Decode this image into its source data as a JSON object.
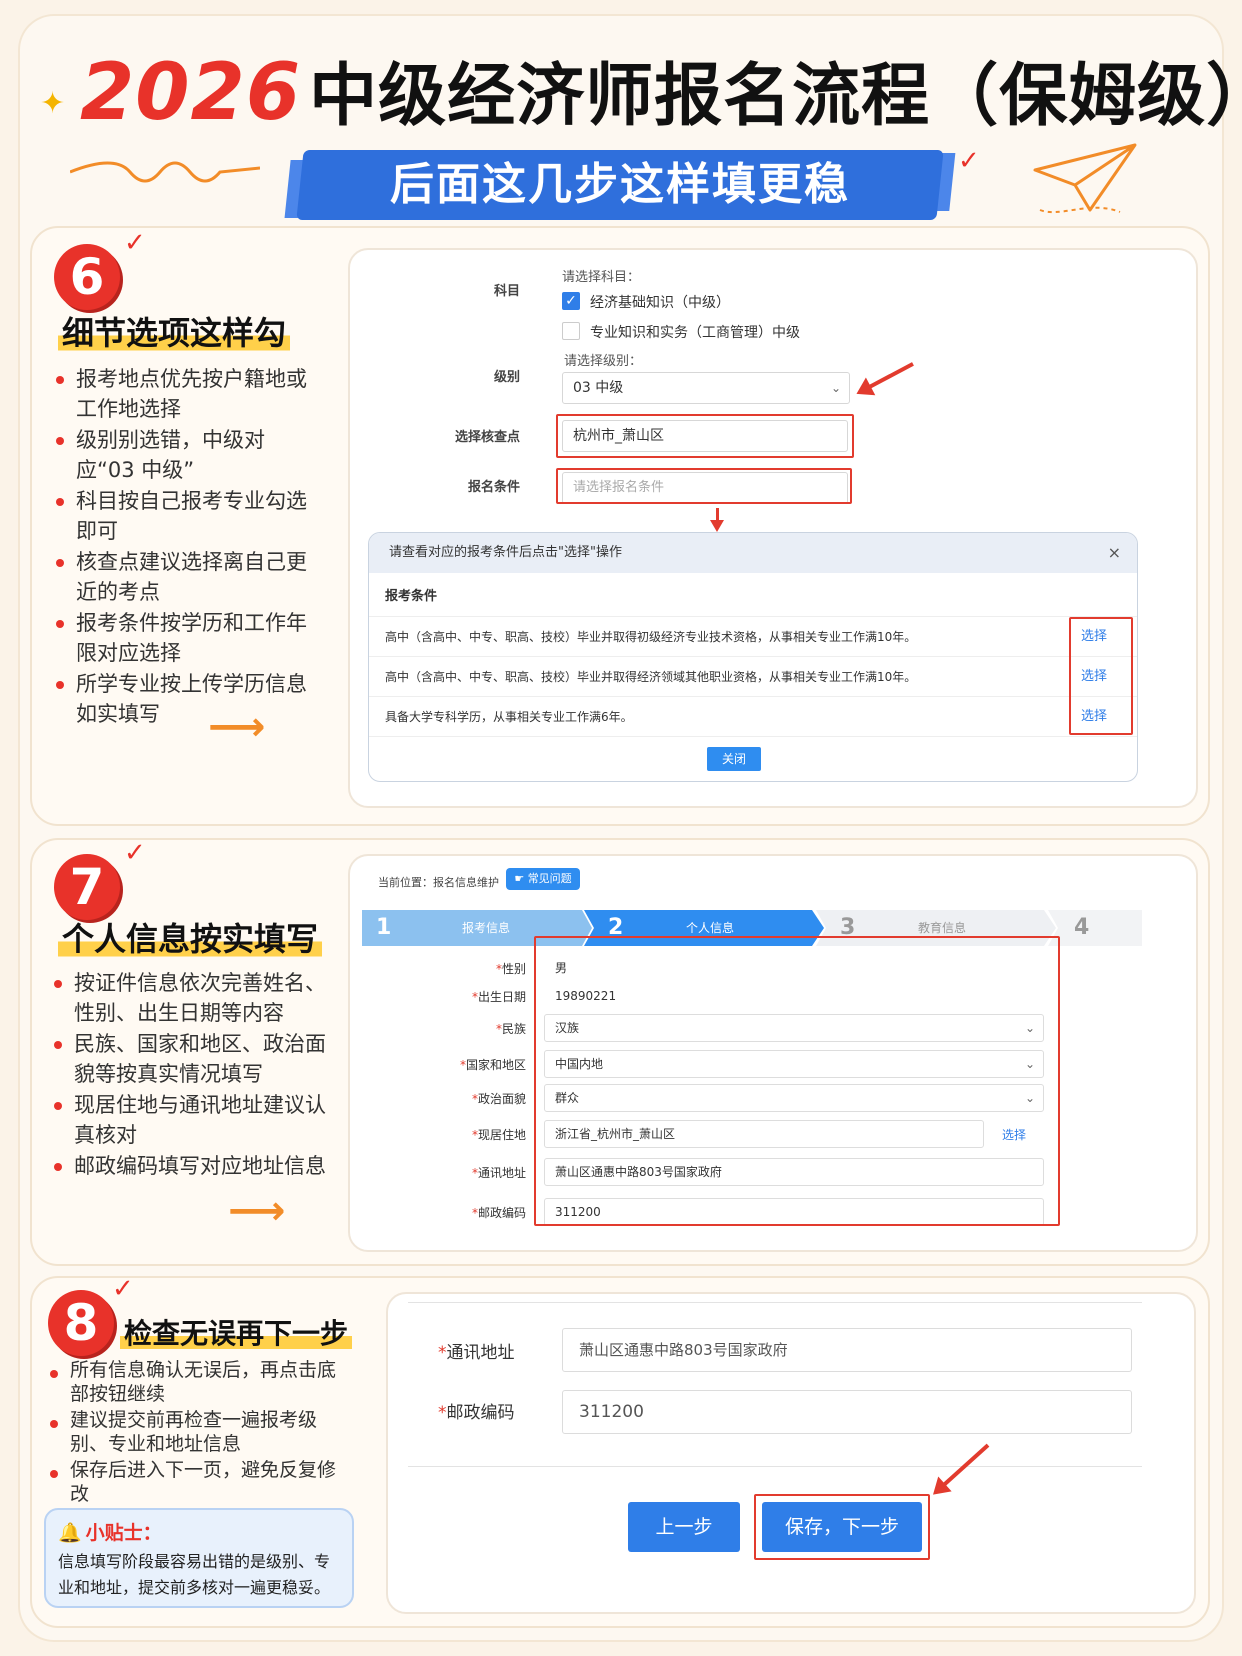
{
  "header": {
    "year": "2026",
    "title_rest": "中级经济师报名流程（保姆级）",
    "banner": "后面这几步这样填更稳"
  },
  "sec6": {
    "num": "6",
    "title": "细节选项这样勾",
    "bullets": [
      "报考地点优先按户籍地或工作地选择",
      "级别别选错，中级对应“03 中级”",
      "科目按自己报考专业勾选即可",
      "核查点建议选择离自己更近的考点",
      "报考条件按学历和工作年限对应选择",
      "所学专业按上传学历信息如实填写"
    ],
    "screen": {
      "subject_label": "科目",
      "subject_hint": "请选择科目：",
      "subject_opt1": "经济基础知识（中级）",
      "subject_opt2": "专业知识和实务（工商管理）中级",
      "level_hint": "请选择级别：",
      "level_label": "级别",
      "level_value": "03 中级",
      "check_label": "选择核查点",
      "check_value": "杭州市_萧山区",
      "cond_label": "报名条件",
      "cond_placeholder": "请选择报名条件",
      "dialog_title": "请查看对应的报考条件后点击\"选择\"操作",
      "dialog_close_icon": "×",
      "dialog_sub": "报考条件",
      "conditions": [
        "高中（含高中、中专、职高、技校）毕业并取得初级经济专业技术资格，从事相关专业工作满10年。",
        "高中（含高中、中专、职高、技校）毕业并取得经济领域其他职业资格，从事相关专业工作满10年。",
        "具备大学专科学历，从事相关专业工作满6年。"
      ],
      "select_label": "选择",
      "close_btn": "关闭"
    }
  },
  "sec7": {
    "num": "7",
    "title": "个人信息按实填写",
    "bullets": [
      "按证件信息依次完善姓名、性别、出生日期等内容",
      "民族、国家和地区、政治面貌等按真实情况填写",
      "现居住地与通讯地址建议认真核对",
      "邮政编码填写对应地址信息"
    ],
    "screen": {
      "crumb": "当前位置：报名信息维护",
      "faq": "常见问题",
      "steps": [
        {
          "num": "1",
          "name": "报考信息"
        },
        {
          "num": "2",
          "name": "个人信息"
        },
        {
          "num": "3",
          "name": "教育信息"
        },
        {
          "num": "4",
          "name": ""
        }
      ],
      "rows": [
        {
          "label": "性别",
          "value": "男",
          "type": "plain"
        },
        {
          "label": "出生日期",
          "value": "19890221",
          "type": "plain"
        },
        {
          "label": "民族",
          "value": "汉族",
          "type": "select"
        },
        {
          "label": "国家和地区",
          "value": "中国内地",
          "type": "select"
        },
        {
          "label": "政治面貌",
          "value": "群众",
          "type": "select"
        },
        {
          "label": "现居住地",
          "value": "浙江省_杭州市_萧山区",
          "type": "pick"
        },
        {
          "label": "通讯地址",
          "value": "萧山区通惠中路803号国家政府",
          "type": "input"
        },
        {
          "label": "邮政编码",
          "value": "311200",
          "type": "input"
        }
      ],
      "pick_label": "选择"
    }
  },
  "sec8": {
    "num": "8",
    "title": "检查无误再下一步",
    "bullets": [
      "所有信息确认无误后，再点击底部按钮继续",
      "建议提交前再检查一遍报考级别、专业和地址信息",
      "保存后进入下一页，避免反复修改"
    ],
    "tip_title": "小贴士：",
    "tip_text": "信息填写阶段最容易出错的是级别、专业和地址，提交前多核对一遍更稳妥。",
    "screen": {
      "addr_label": "通讯地址",
      "addr_value": "萧山区通惠中路803号国家政府",
      "zip_label": "邮政编码",
      "zip_value": "311200",
      "prev": "上一步",
      "next": "保存，下一步"
    }
  },
  "colors": {
    "accent_red": "#e8322a",
    "accent_blue": "#2f7ee8",
    "highlight": "#ffd04a"
  }
}
